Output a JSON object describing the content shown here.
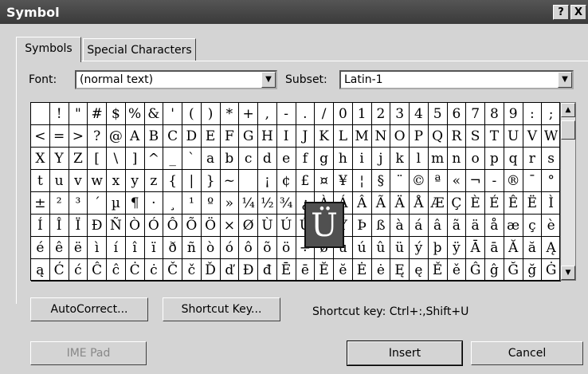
{
  "window": {
    "title": "Symbol",
    "help_label": "?",
    "close_label": "X"
  },
  "tabs": [
    {
      "label": "Symbols"
    },
    {
      "label": "Special Characters"
    }
  ],
  "font": {
    "label": "Font:",
    "value": "(normal text)"
  },
  "subset": {
    "label": "Subset:",
    "value": "Latin-1"
  },
  "symbol_rows": [
    [
      " ",
      "!",
      "\"",
      "#",
      "$",
      "%",
      "&",
      "'",
      "(",
      ")",
      "*",
      "+",
      ",",
      "-",
      ".",
      "/",
      "0",
      "1",
      "2",
      "3",
      "4",
      "5",
      "6",
      "7",
      "8",
      "9",
      ":",
      ";"
    ],
    [
      "<",
      "=",
      ">",
      "?",
      "@",
      "A",
      "B",
      "C",
      "D",
      "E",
      "F",
      "G",
      "H",
      "I",
      "J",
      "K",
      "L",
      "M",
      "N",
      "O",
      "P",
      "Q",
      "R",
      "S",
      "T",
      "U",
      "V",
      "W"
    ],
    [
      "X",
      "Y",
      "Z",
      "[",
      "\\",
      "]",
      "^",
      "_",
      "`",
      "a",
      "b",
      "c",
      "d",
      "e",
      "f",
      "g",
      "h",
      "i",
      "j",
      "k",
      "l",
      "m",
      "n",
      "o",
      "p",
      "q",
      "r",
      "s"
    ],
    [
      "t",
      "u",
      "v",
      "w",
      "x",
      "y",
      "z",
      "{",
      "|",
      "}",
      "~",
      " ",
      "¡",
      "¢",
      "£",
      "¤",
      "¥",
      "¦",
      "§",
      "¨",
      "©",
      "ª",
      "«",
      "¬",
      "-",
      "®",
      "¯",
      "°"
    ],
    [
      "±",
      "²",
      "³",
      "´",
      "µ",
      "¶",
      "·",
      "¸",
      "¹",
      "º",
      "»",
      "¼",
      "½",
      "¾",
      "¿",
      "À",
      "Á",
      "Â",
      "Ã",
      "Ä",
      "Å",
      "Æ",
      "Ç",
      "È",
      "É",
      "Ê",
      "Ë",
      "Ì"
    ],
    [
      "Í",
      "Î",
      "Ï",
      "Ð",
      "Ñ",
      "Ò",
      "Ó",
      "Ô",
      "Õ",
      "Ö",
      "×",
      "Ø",
      "Ù",
      "Ú",
      "Û",
      "Ü",
      "Ý",
      "Þ",
      "ß",
      "à",
      "á",
      "â",
      "ã",
      "ä",
      "å",
      "æ",
      "ç",
      "è"
    ],
    [
      "é",
      "ê",
      "ë",
      "ì",
      "í",
      "î",
      "ï",
      "ð",
      "ñ",
      "ò",
      "ó",
      "ô",
      "õ",
      "ö",
      "÷",
      "ø",
      "ù",
      "ú",
      "û",
      "ü",
      "ý",
      "þ",
      "ÿ",
      "Ā",
      "ā",
      "Ă",
      "ă",
      "Ą"
    ],
    [
      "ą",
      "Ć",
      "ć",
      "Ĉ",
      "ĉ",
      "Ċ",
      "ċ",
      "Č",
      "č",
      "Ď",
      "ď",
      "Đ",
      "đ",
      "Ē",
      "ē",
      "Ĕ",
      "ĕ",
      "Ė",
      "ė",
      "Ę",
      "ę",
      "Ě",
      "ě",
      "Ĝ",
      "ĝ",
      "Ğ",
      "ğ",
      "Ġ"
    ]
  ],
  "selected_symbol": "Ü",
  "buttons": {
    "autocorrect": "AutoCorrect...",
    "shortcut_key": "Shortcut Key...",
    "ime_pad": "IME Pad",
    "insert": "Insert",
    "cancel": "Cancel"
  },
  "shortcut_text": "Shortcut key:  Ctrl+:,Shift+U"
}
